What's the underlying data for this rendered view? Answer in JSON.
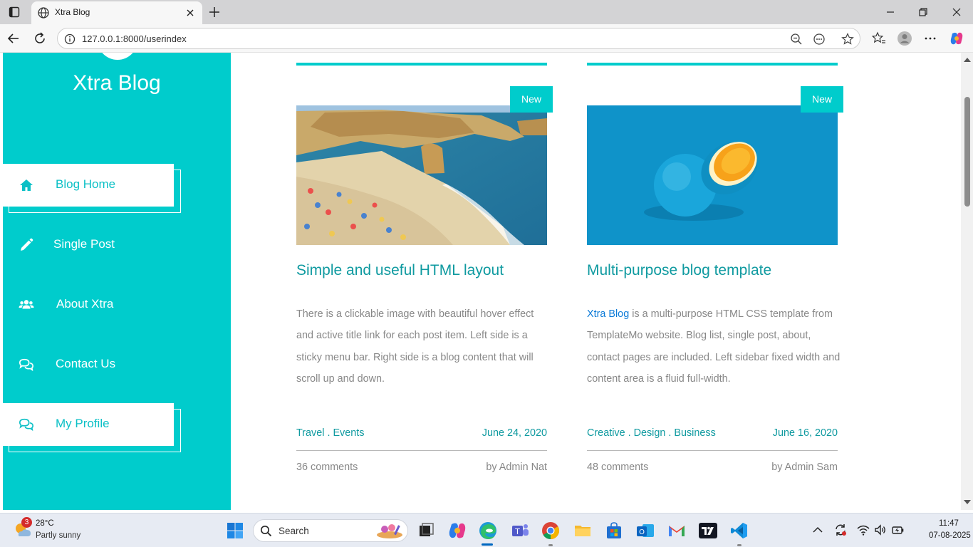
{
  "browser": {
    "tab_title": "Xtra Blog",
    "url": "127.0.0.1:8000/userindex"
  },
  "sidebar": {
    "site_title": "Xtra Blog",
    "items": [
      {
        "label": "Blog Home",
        "icon": "home-icon",
        "active": true
      },
      {
        "label": "Single Post",
        "icon": "pencil-icon",
        "active": false
      },
      {
        "label": "About Xtra",
        "icon": "users-icon",
        "active": false
      },
      {
        "label": "Contact Us",
        "icon": "chat-icon",
        "active": false
      },
      {
        "label": "My Profile",
        "icon": "chat-icon",
        "active": true
      }
    ]
  },
  "posts": [
    {
      "badge": "New",
      "title": "Simple and useful HTML layout",
      "body": "There is a clickable image with beautiful hover effect and active title link for each post item. Left side is a sticky menu bar. Right side is a blog content that will scroll up and down.",
      "categories": "Travel . Events",
      "date": "June 24, 2020",
      "comments": "36 comments",
      "author": "by Admin Nat",
      "image": "beach-photo"
    },
    {
      "badge": "New",
      "title": "Multi-purpose blog template",
      "body_link": "Xtra Blog",
      "body": " is a multi-purpose HTML CSS template from TemplateMo website. Blog list, single post, about, contact pages are included. Left sidebar fixed width and content area is a fluid full-width.",
      "categories": "Creative . Design . Business",
      "date": "June 16, 2020",
      "comments": "48 comments",
      "author": "by Admin Sam",
      "image": "orange-photo"
    }
  ],
  "taskbar": {
    "weather_temp": "28°C",
    "weather_desc": "Partly sunny",
    "weather_badge": "3",
    "search_label": "Search",
    "time": "11:47",
    "date": "07-08-2025"
  },
  "colors": {
    "accent": "#00cccc",
    "title_teal": "#0f9aa0",
    "link_blue": "#0b7ad8",
    "body_gray": "#888888"
  }
}
